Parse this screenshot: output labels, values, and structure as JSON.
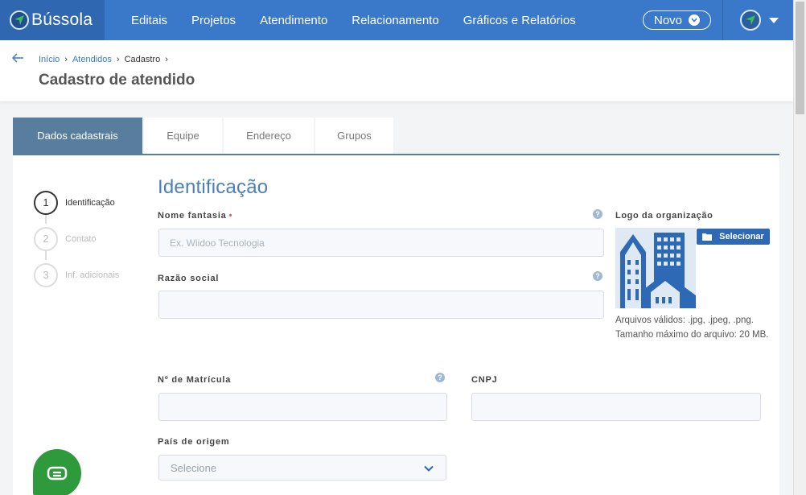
{
  "app": {
    "name": "Bússola"
  },
  "nav": {
    "items": [
      "Editais",
      "Projetos",
      "Atendimento",
      "Relacionamento",
      "Gráficos e Relatórios"
    ],
    "novo_label": "Novo"
  },
  "breadcrumb": {
    "items": [
      "Início",
      "Atendidos",
      "Cadastro"
    ]
  },
  "page": {
    "title": "Cadastro de atendido"
  },
  "tabs": [
    "Dados cadastrais",
    "Equipe",
    "Endereço",
    "Grupos"
  ],
  "steps": [
    {
      "number": "1",
      "label": "Identificação"
    },
    {
      "number": "2",
      "label": "Contato"
    },
    {
      "number": "3",
      "label": "Inf. adicionais"
    }
  ],
  "form": {
    "section_title": "Identificação",
    "nome_fantasia": {
      "label": "Nome fantasia",
      "placeholder": "Ex. Wiidoo Tecnologia",
      "required_mark": "•"
    },
    "razao_social": {
      "label": "Razão social",
      "value": ""
    },
    "matricula": {
      "label": "Nº de Matrícula",
      "value": ""
    },
    "cnpj": {
      "label": "CNPJ",
      "value": ""
    },
    "pais": {
      "label": "País de origem",
      "selected": "Selecione"
    },
    "help_glyph": "?"
  },
  "logo": {
    "label": "Logo da organização",
    "button_label": "Selecionar",
    "hint": "Arquivos válidos: .jpg, .jpeg, .png. Tamanho máximo do arquivo: 20 MB."
  },
  "colors": {
    "nav_bg": "#3a78c9",
    "tab_active": "#587d9f",
    "accent": "#4a7fb8",
    "chat_green": "#2e9a3c"
  }
}
